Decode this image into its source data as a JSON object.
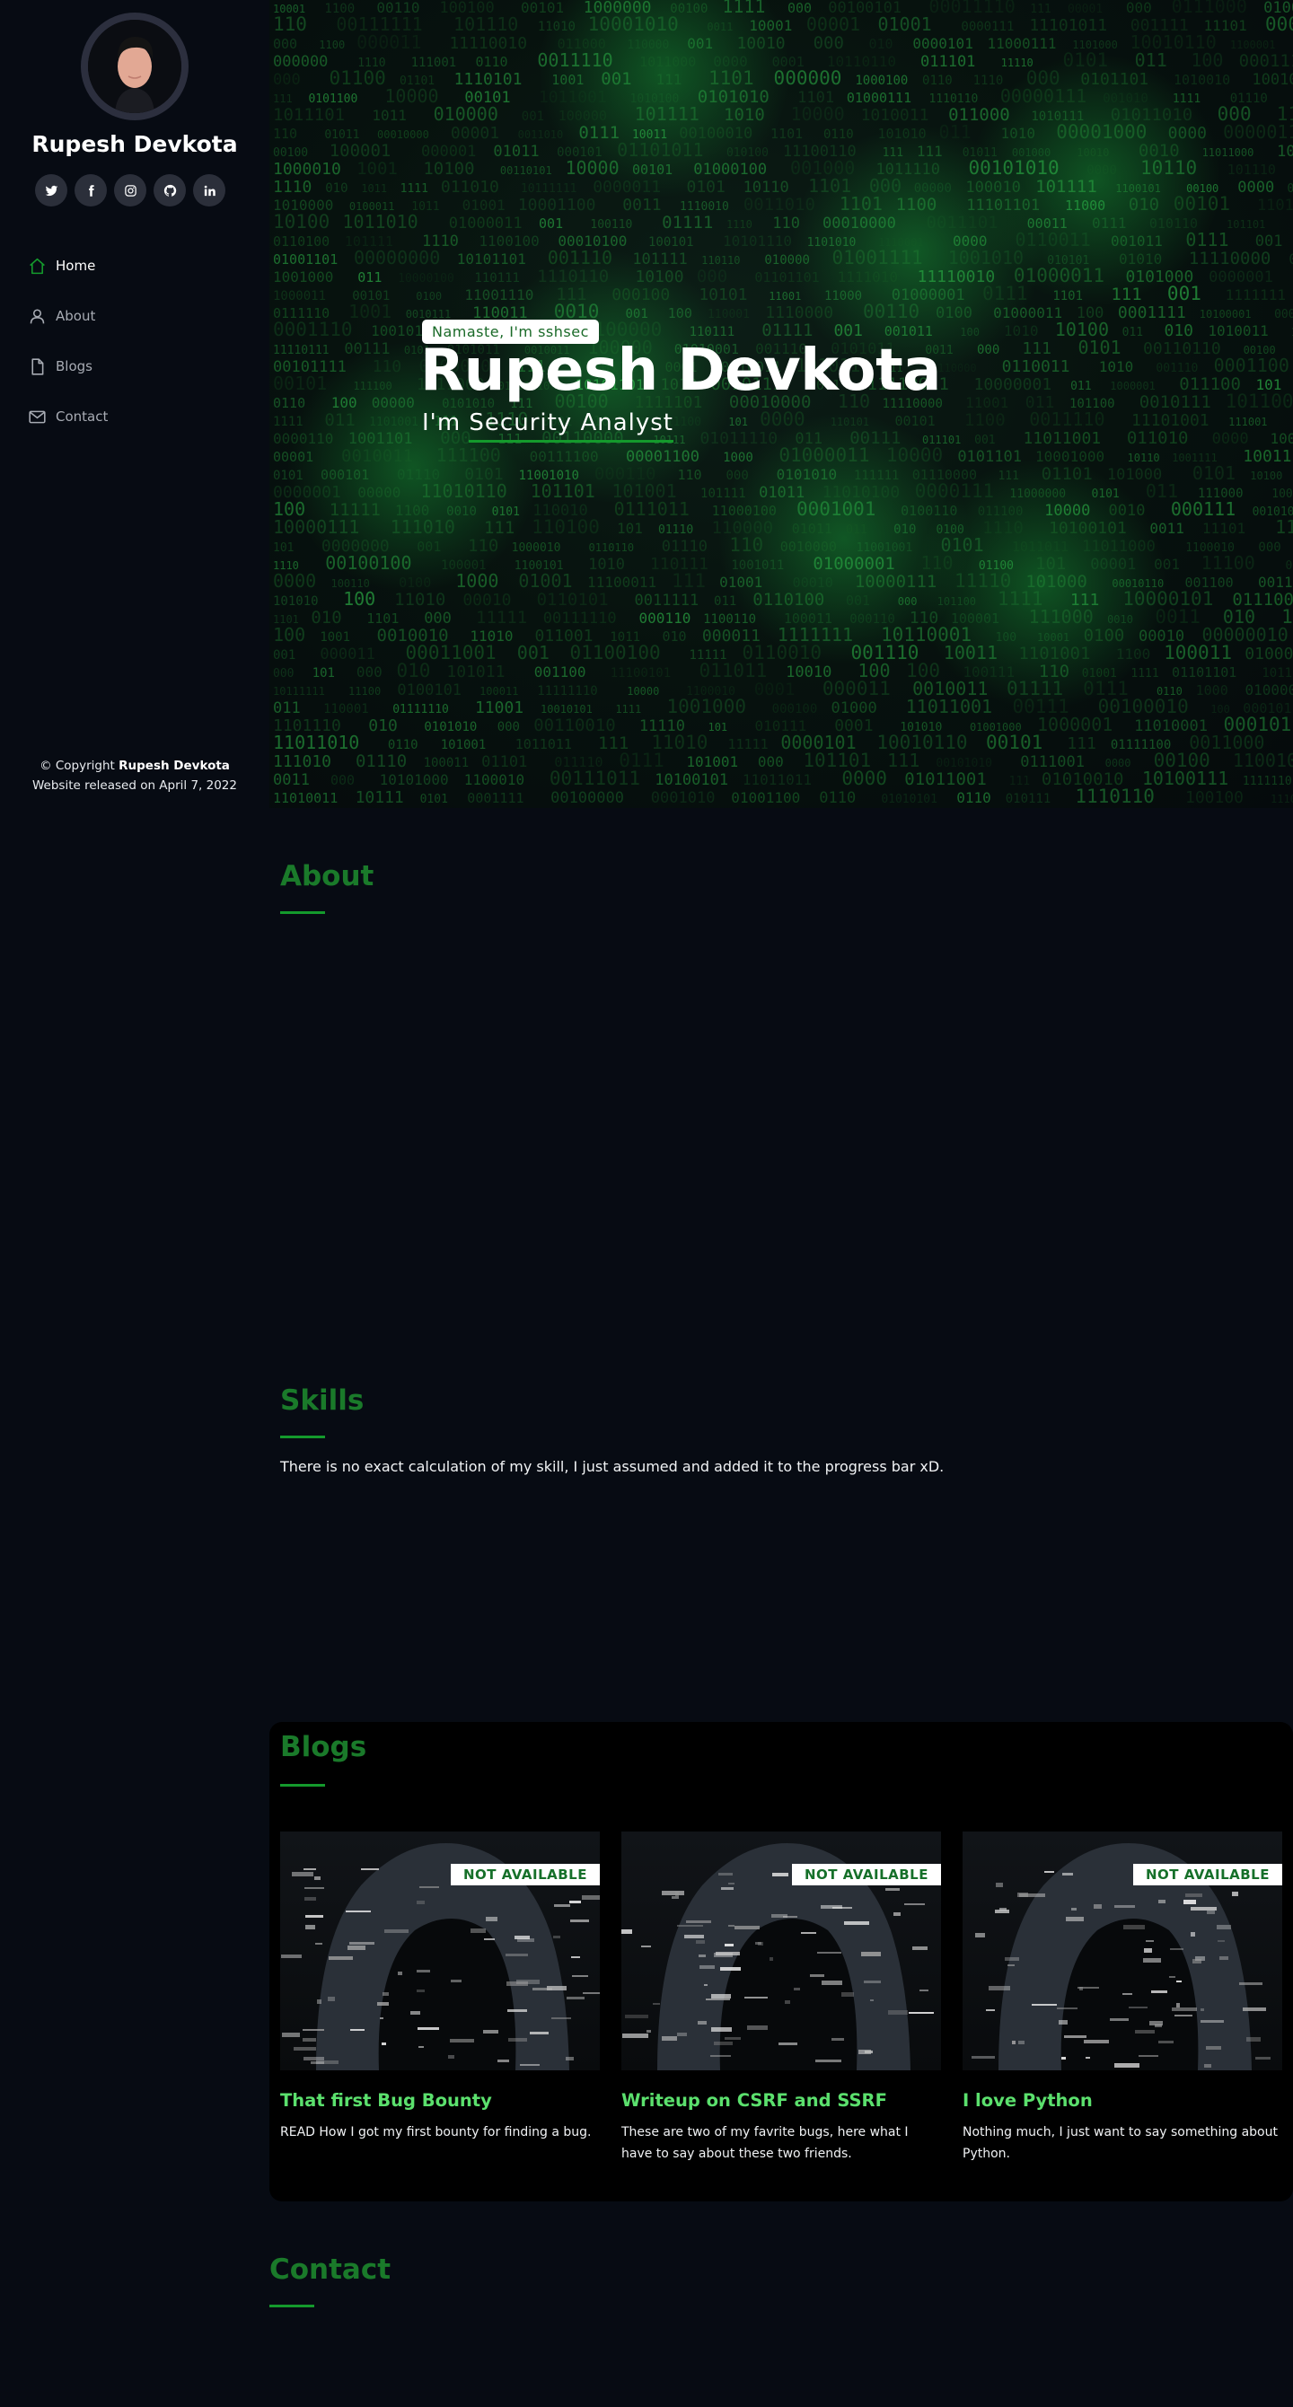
{
  "sidebar": {
    "name": "Rupesh Devkota",
    "social": [
      {
        "icon": "twitter-icon"
      },
      {
        "icon": "facebook-icon"
      },
      {
        "icon": "instagram-icon"
      },
      {
        "icon": "github-icon"
      },
      {
        "icon": "linkedin-icon"
      }
    ],
    "nav": [
      {
        "label": "Home",
        "icon": "home-icon",
        "active": true
      },
      {
        "label": "About",
        "icon": "user-icon",
        "active": false
      },
      {
        "label": "Blogs",
        "icon": "file-icon",
        "active": false
      },
      {
        "label": "Contact",
        "icon": "envelope-icon",
        "active": false
      }
    ],
    "footer": {
      "copyright_prefix": "© Copyright",
      "copyright_name": "Rupesh Devkota",
      "release": "Website released on April 7, 2022"
    }
  },
  "hero": {
    "greeting": "Namaste, I'm sshsec",
    "name": "Rupesh Devkota",
    "role_prefix": "I'm",
    "role_title": "Security Analyst"
  },
  "sections": {
    "about": {
      "title": "About"
    },
    "skills": {
      "title": "Skills",
      "text": "There is no exact calculation of my skill, I just assumed and added it to the progress bar xD."
    },
    "blogs": {
      "title": "Blogs",
      "cards": [
        {
          "badge": "NOT AVAILABLE",
          "title": "That first Bug Bounty",
          "description": "READ How I got my first bounty for finding a bug."
        },
        {
          "badge": "NOT AVAILABLE",
          "title": "Writeup on CSRF and SSRF",
          "description": "These are two of my favrite bugs, here what I have to say about these two friends."
        },
        {
          "badge": "NOT AVAILABLE",
          "title": "I love Python",
          "description": "Nothing much, I just want to say something about Python."
        }
      ]
    },
    "contact": {
      "title": "Contact"
    }
  },
  "colors": {
    "background": "#070b13",
    "accent_green": "#149a2c",
    "section_title_green": "#1a7a2a",
    "blog_title_green": "#5be06d",
    "social_bg": "#2b2f3a"
  }
}
